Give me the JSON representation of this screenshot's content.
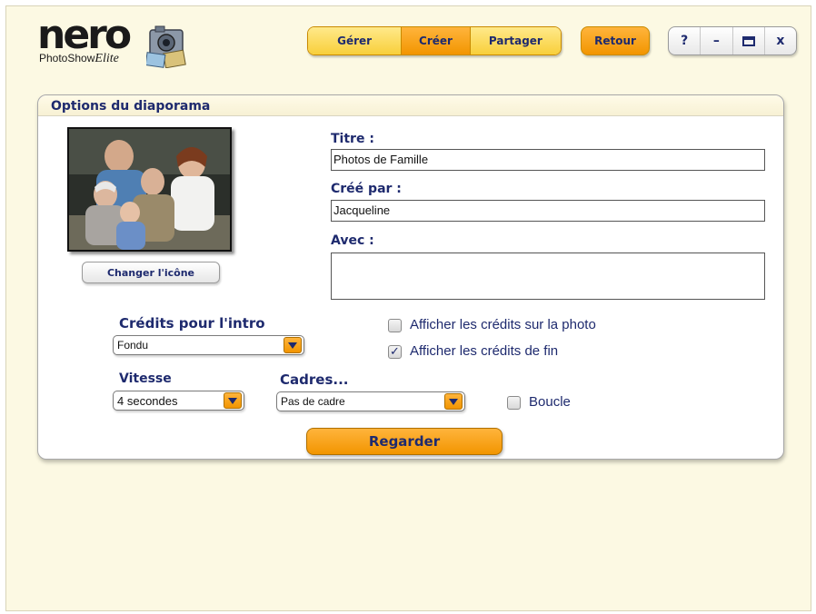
{
  "logo": {
    "brand": "nero",
    "product": "PhotoShow",
    "edition": "Elite"
  },
  "nav": {
    "tabs": [
      {
        "label": "Gérer"
      },
      {
        "label": "Créer",
        "active": true
      },
      {
        "label": "Partager"
      }
    ],
    "back_label": "Retour"
  },
  "window_controls": {
    "help": "?",
    "minimize": "–",
    "close": "x"
  },
  "panel": {
    "title": "Options du diaporama",
    "change_icon_label": "Changer l'icône",
    "title_label": "Titre :",
    "title_value": "Photos de Famille",
    "created_by_label": "Créé par :",
    "created_by_value": "Jacqueline",
    "with_label": "Avec :",
    "with_value": "",
    "intro_credits_label": "Crédits pour l'intro",
    "intro_credits_value": "Fondu",
    "show_credits_on_photo": {
      "label": "Afficher les crédits sur la photo",
      "checked": false
    },
    "show_end_credits": {
      "label": "Afficher les crédits de fin",
      "checked": true
    },
    "speed_label": "Vitesse",
    "speed_value": "4 secondes",
    "frames_label": "Cadres...",
    "frames_value": "Pas de cadre",
    "loop": {
      "label": "Boucle",
      "checked": false
    },
    "watch_label": "Regarder"
  },
  "colors": {
    "accent_orange": "#f29500",
    "nav_yellow": "#f8cf3a",
    "label_navy": "#1e2a6e",
    "background": "#fcf9e3"
  }
}
